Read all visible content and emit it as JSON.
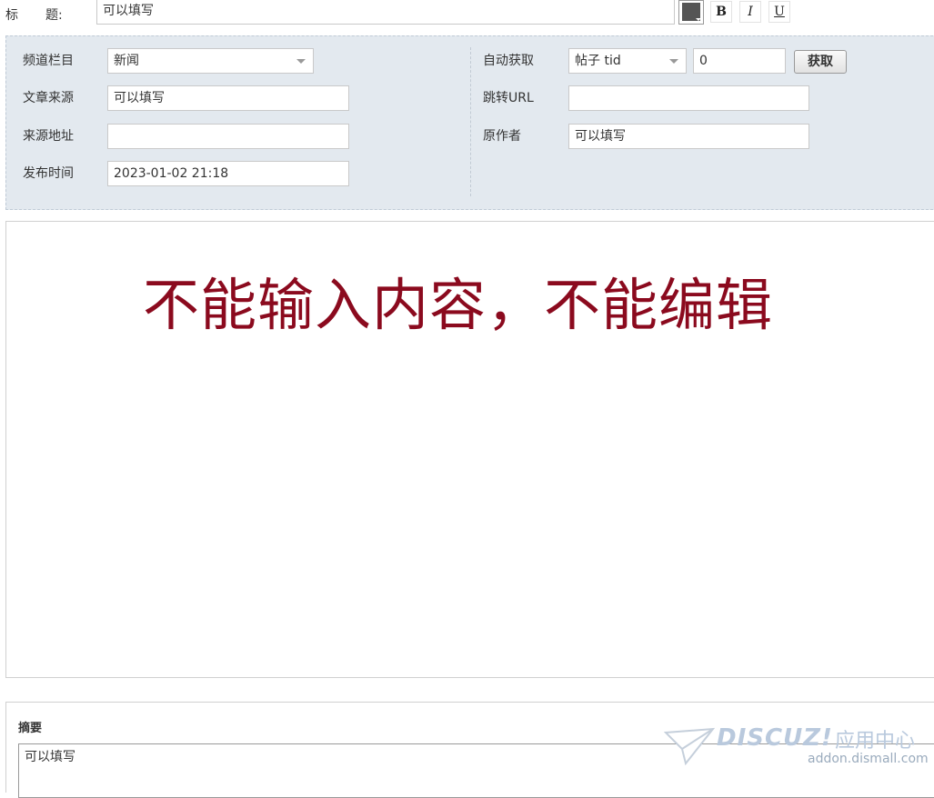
{
  "title_row": {
    "label_1": "标",
    "label_2": "题:",
    "value": "可以填写",
    "bold_label": "B",
    "italic_label": "I",
    "underline_label": "U"
  },
  "meta": {
    "channel_label": "频道栏目",
    "channel_value": "新闻",
    "source_label": "文章来源",
    "source_value": "可以填写",
    "source_url_label": "来源地址",
    "source_url_value": "",
    "publish_time_label": "发布时间",
    "publish_time_value": "2023-01-02 21:18",
    "auto_fetch_label": "自动获取",
    "auto_fetch_type": "帖子 tid",
    "auto_fetch_id": "0",
    "fetch_button_label": "获取",
    "redirect_url_label": "跳转URL",
    "redirect_url_value": "",
    "author_label": "原作者",
    "author_value": "可以填写"
  },
  "editor": {
    "message": "不能输入内容，不能编辑"
  },
  "summary": {
    "label": "摘要",
    "value": "可以填写"
  },
  "watermark": {
    "name": "DISCUZ!",
    "sub": "应用中心",
    "url": "addon.dismall.com"
  },
  "colors": {
    "panel_bg": "#e3e9ef",
    "editor_message": "#8b0a1e",
    "color_swatch": "#555555"
  }
}
